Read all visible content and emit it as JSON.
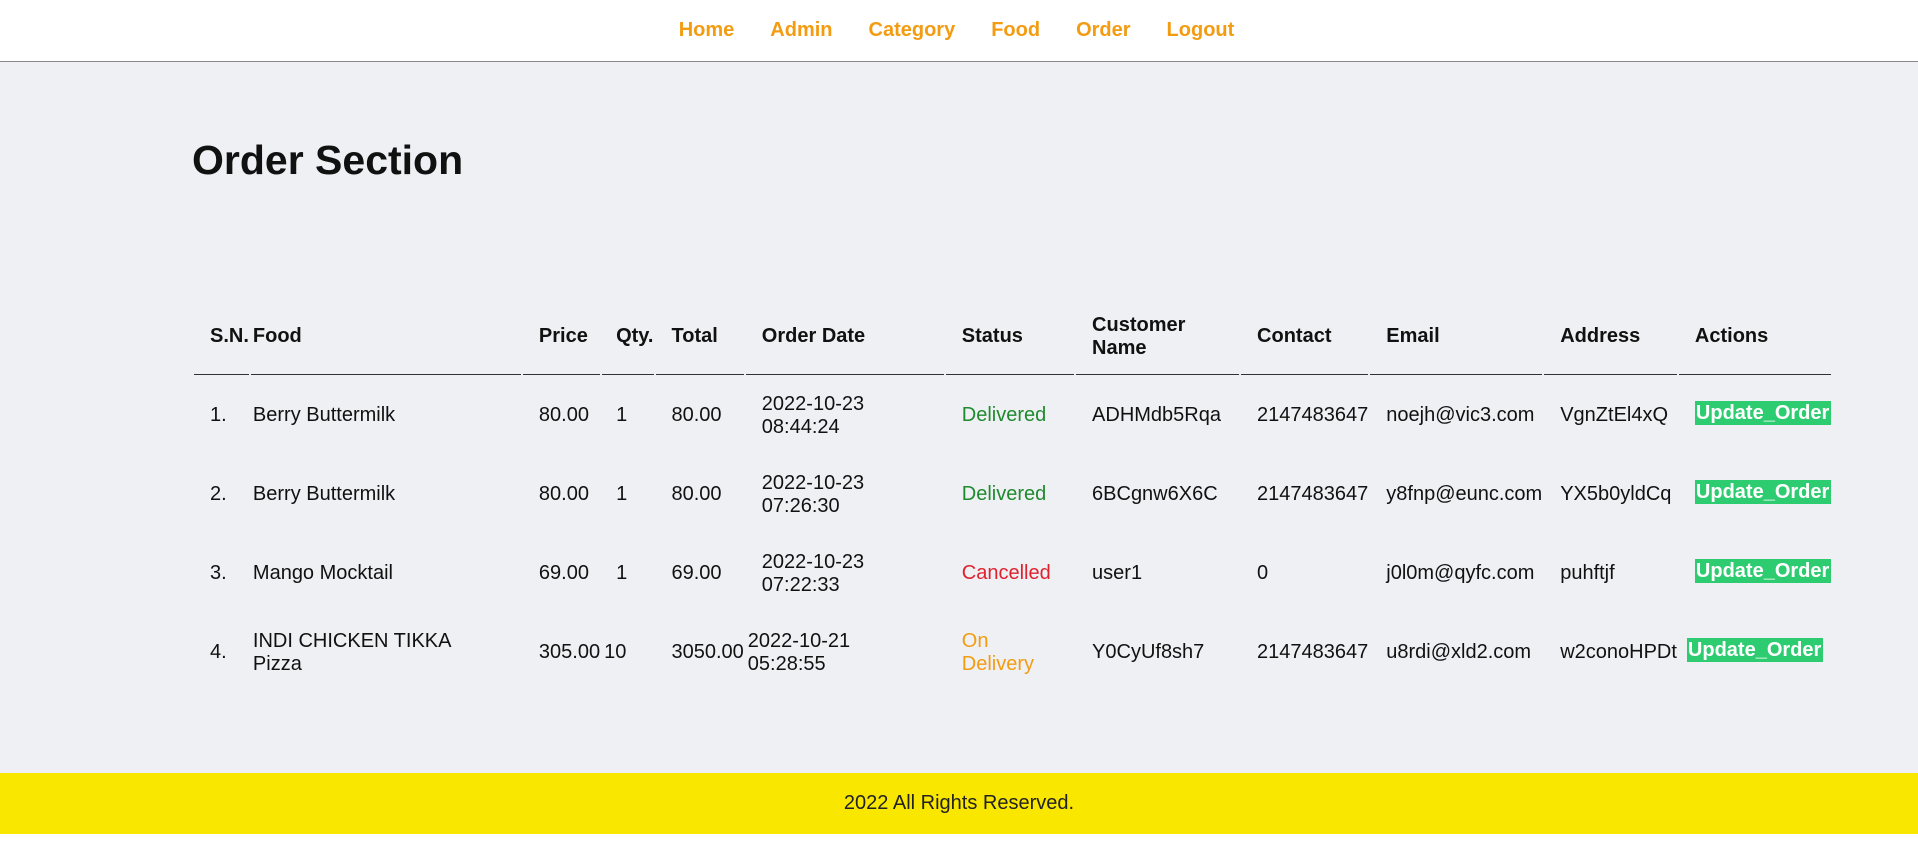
{
  "nav": {
    "items": [
      {
        "label": "Home"
      },
      {
        "label": "Admin"
      },
      {
        "label": "Category"
      },
      {
        "label": "Food"
      },
      {
        "label": "Order"
      },
      {
        "label": "Logout"
      }
    ],
    "color": "#f39c12"
  },
  "page": {
    "title": "Order Section"
  },
  "table": {
    "headers": {
      "sn": "S.N.",
      "food": "Food",
      "price": "Price",
      "qty": "Qty.",
      "total": "Total",
      "order_date": "Order Date",
      "status": "Status",
      "customer_name": "Customer Name",
      "contact": "Contact",
      "email": "Email",
      "address": "Address",
      "actions": "Actions"
    },
    "rows": [
      {
        "sn": "1.",
        "food": "Berry Buttermilk",
        "price": "80.00",
        "qty": "1",
        "total": "80.00",
        "order_date": "2022-10-23 08:44:24",
        "status": "Delivered",
        "customer_name": "ADHMdb5Rqa",
        "contact": "2147483647",
        "email": "noejh@vic3.com",
        "address": "VgnZtEl4xQ",
        "action_label": "Update_Order"
      },
      {
        "sn": "2.",
        "food": "Berry Buttermilk",
        "price": "80.00",
        "qty": "1",
        "total": "80.00",
        "order_date": "2022-10-23 07:26:30",
        "status": "Delivered",
        "customer_name": "6BCgnw6X6C",
        "contact": "2147483647",
        "email": "y8fnp@eunc.com",
        "address": "YX5b0yldCq",
        "action_label": "Update_Order"
      },
      {
        "sn": "3.",
        "food": "Mango Mocktail",
        "price": "69.00",
        "qty": "1",
        "total": "69.00",
        "order_date": "2022-10-23 07:22:33",
        "status": "Cancelled",
        "customer_name": "user1",
        "contact": "0",
        "email": "j0l0m@qyfc.com",
        "address": "puhftjf",
        "action_label": "Update_Order"
      },
      {
        "sn": "4.",
        "food": "INDI CHICKEN TIKKA Pizza",
        "price": "305.00",
        "qty": "10",
        "total": "3050.00",
        "order_date": "2022-10-21 05:28:55",
        "status": "On Delivery",
        "customer_name": "Y0CyUf8sh7",
        "contact": "2147483647",
        "email": "u8rdi@xld2.com",
        "address": "w2conoHPDt",
        "action_label": "Update_Order"
      }
    ],
    "status_colors": {
      "Delivered": "#1f8a2e",
      "Cancelled": "#e0222f",
      "On Delivery": "#f39c12"
    },
    "action_button_color": "#2ecc71"
  },
  "footer": {
    "text": "2022 All Rights Reserved.",
    "background": "#f9e700"
  }
}
